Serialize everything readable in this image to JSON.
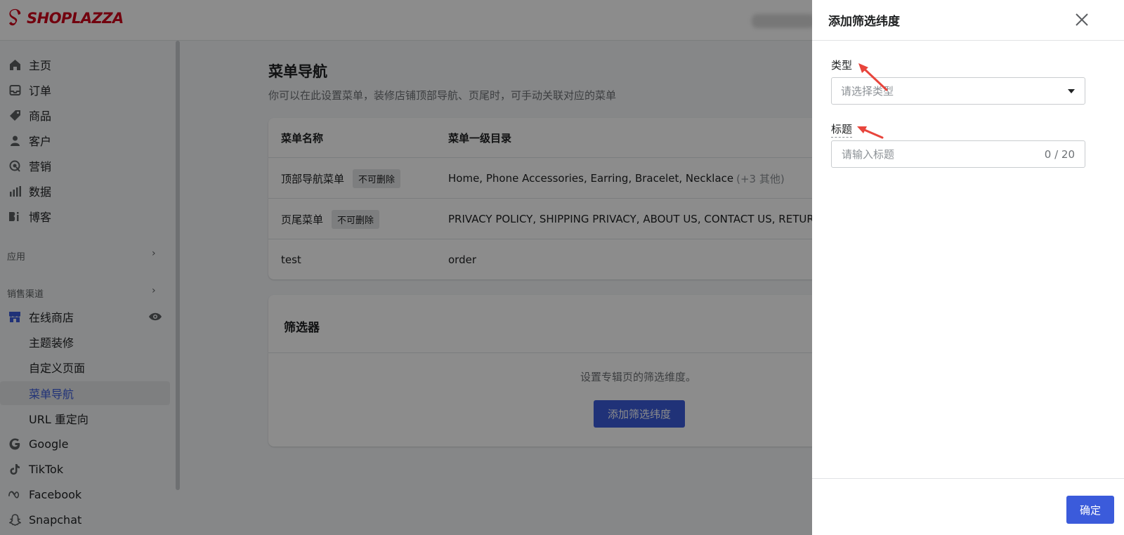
{
  "brand": {
    "name": "SHOPLAZZA",
    "color": "#d0021b"
  },
  "sidebar": {
    "items": [
      {
        "label": "主页",
        "icon": "home-icon"
      },
      {
        "label": "订单",
        "icon": "inbox-icon"
      },
      {
        "label": "商品",
        "icon": "tag-icon"
      },
      {
        "label": "客户",
        "icon": "person-icon"
      },
      {
        "label": "营销",
        "icon": "target-icon"
      },
      {
        "label": "数据",
        "icon": "bar-chart-icon"
      },
      {
        "label": "博客",
        "icon": "blog-icon"
      }
    ],
    "apps_label": "应用",
    "channels_label": "销售渠道",
    "online_store": {
      "label": "在线商店",
      "icon": "store-icon"
    },
    "sub_items": [
      "主题装修",
      "自定义页面",
      "菜单导航",
      "URL 重定向"
    ],
    "active_sub": "菜单导航",
    "channels": [
      {
        "label": "Google",
        "icon": "google-icon"
      },
      {
        "label": "TikTok",
        "icon": "tiktok-icon"
      },
      {
        "label": "Facebook",
        "icon": "meta-icon"
      },
      {
        "label": "Snapchat",
        "icon": "snapchat-icon"
      }
    ]
  },
  "main": {
    "title": "菜单导航",
    "description": "你可以在此设置菜单，装修店铺顶部导航、页尾时，可手动关联对应的菜单",
    "table": {
      "headers": [
        "菜单名称",
        "菜单一级目录"
      ],
      "rows": [
        {
          "name": "顶部导航菜单",
          "badge": "不可删除",
          "items": "Home, Phone Accessories, Earring, Bracelet, Necklace",
          "more": "(+3 其他)"
        },
        {
          "name": "页尾菜单",
          "badge": "不可删除",
          "items": "PRIVACY POLICY, SHIPPING PRIVACY, ABOUT US, CONTACT US, RETURN",
          "more": ""
        },
        {
          "name": "test",
          "badge": "",
          "items": "order",
          "more": ""
        }
      ]
    },
    "filter": {
      "title": "筛选器",
      "description": "设置专辑页的筛选维度。",
      "button_label": "添加筛选纬度"
    }
  },
  "drawer": {
    "title": "添加筛选纬度",
    "type_label": "类型",
    "type_placeholder": "请选择类型",
    "title_label": "标题",
    "title_placeholder": "请输入标题",
    "char_count": "0 / 20",
    "confirm_label": "确定"
  },
  "colors": {
    "accent": "#3b5bdb",
    "annotation_arrow": "#e8453c"
  }
}
